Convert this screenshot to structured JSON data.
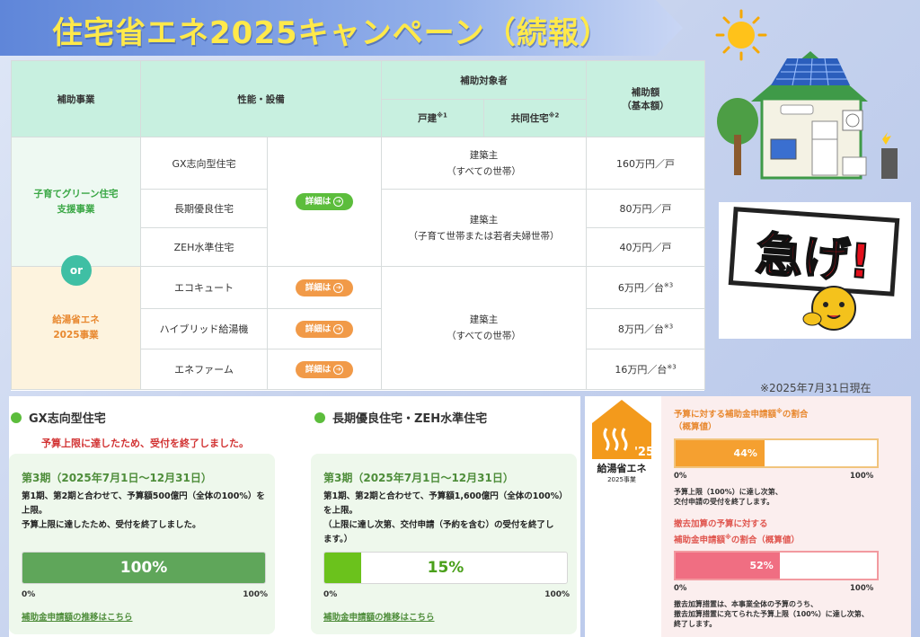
{
  "banner": {
    "title": "住宅省エネ2025キャンペーン（続報）"
  },
  "side": {
    "warning_text": "急げ!",
    "date_note": "※2025年7月31日現在"
  },
  "table": {
    "headers": {
      "program": "補助事業",
      "performance": "性能・設備",
      "target_group": "補助対象者",
      "detached": "戸建",
      "detached_sup": "※1",
      "collective": "共同住宅",
      "collective_sup": "※2",
      "amount": "補助額",
      "amount_sub": "（基本額）"
    },
    "programs": [
      {
        "name_line1": "子育てグリーン住宅",
        "name_line2": "支援事業"
      },
      {
        "name_line1": "給湯省エネ",
        "name_line2": "2025事業"
      }
    ],
    "or_label": "or",
    "detail_button": "詳細は",
    "rows": [
      {
        "item": "GX志向型住宅",
        "amount": "160万円／戸",
        "amount_sup": ""
      },
      {
        "item": "長期優良住宅",
        "amount": "80万円／戸",
        "amount_sup": ""
      },
      {
        "item": "ZEH水準住宅",
        "amount": "40万円／戸",
        "amount_sup": ""
      },
      {
        "item": "エコキュート",
        "amount": "6万円／台",
        "amount_sup": "※3"
      },
      {
        "item": "ハイブリッド給湯機",
        "amount": "8万円／台",
        "amount_sup": "※3"
      },
      {
        "item": "エネファーム",
        "amount": "16万円／台",
        "amount_sup": "※3"
      }
    ],
    "targets": [
      {
        "line1": "建築主",
        "line2": "（すべての世帯）"
      },
      {
        "line1": "建築主",
        "line2": "（子育て世帯または若者夫婦世帯）"
      },
      {
        "line1": "建築主",
        "line2": "（すべての世帯）"
      }
    ]
  },
  "gx": {
    "heading": "GX志向型住宅",
    "ended_notice": "予算上限に達したため、受付を終了しました。",
    "period": "第3期（2025年7月1日～12月31日）",
    "desc_line1": "第1期、第2期と合わせて、予算額500億円（全体の100%）を",
    "desc_line2": "上限。",
    "desc_line3": "予算上限に達したため、受付を終了しました。",
    "progress_percent": 100,
    "progress_label": "100%",
    "axis_min": "0%",
    "axis_max": "100%",
    "link": "補助金申請額の推移はこちら",
    "color": "#5fa65a"
  },
  "choki": {
    "heading": "長期優良住宅・ZEH水準住宅",
    "period": "第3期（2025年7月1日～12月31日）",
    "desc_line1": "第1期、第2期と合わせて、予算額1,600億円（全体の100%）",
    "desc_line2": "を上限。",
    "desc_line3": "（上限に達し次第、交付申請（予約を含む）の受付を終了し",
    "desc_line4": "ます。）",
    "progress_percent": 15,
    "progress_label": "15%",
    "axis_min": "0%",
    "axis_max": "100%",
    "link": "補助金申請額の推移はこちら",
    "color": "#6bc21c"
  },
  "kyuto": {
    "logo_year": "'25",
    "logo_title": "給湯省エネ",
    "logo_sub": "2025事業",
    "budget": {
      "heading_line1": "予算に対する補助金申請額",
      "heading_sup": "※",
      "heading_line1b": "の割合",
      "heading_line2": "（概算値）",
      "progress_percent": 44,
      "progress_label": "44%",
      "axis_min": "0%",
      "axis_max": "100%",
      "note_line1": "予算上限（100%）に達し次第、",
      "note_line2": "交付申請の受付を終了します。",
      "color": "#f5a030"
    },
    "removal": {
      "heading_line1": "撤去加算の予算に対する",
      "heading_line2": "補助金申請額",
      "heading_sup": "※",
      "heading_line2b": "の割合（概算値）",
      "progress_percent": 52,
      "progress_label": "52%",
      "axis_min": "0%",
      "axis_max": "100%",
      "note_line1": "撤去加算措置は、本事業全体の予算のうち、",
      "note_line2": "撤去加算措置に充てられた予算上限（100%）に達し次第、",
      "note_line3": "終了します。",
      "color": "#f06e82"
    }
  }
}
